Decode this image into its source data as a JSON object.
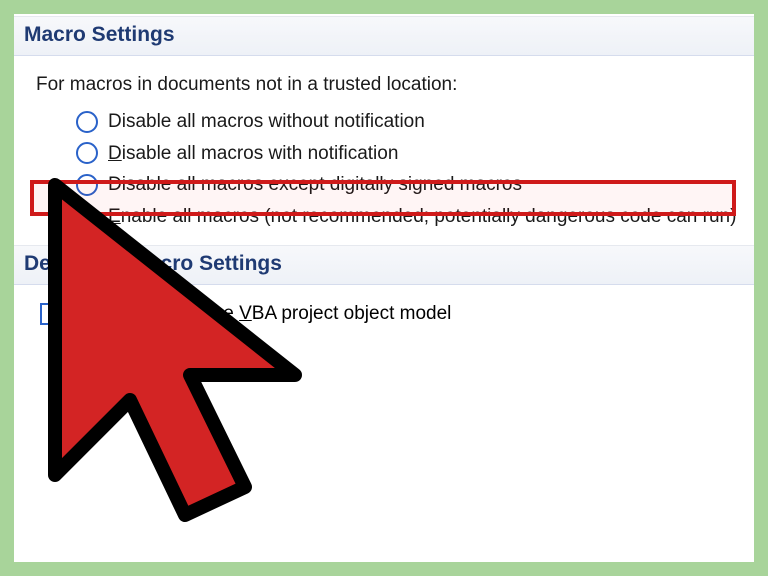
{
  "sections": {
    "macro_settings": {
      "title": "Macro Settings",
      "intro": "For macros in documents not in a trusted location:",
      "options": [
        {
          "pre": "",
          "accel": "",
          "label": "Disable all macros without notification",
          "checked": false
        },
        {
          "pre": "",
          "accel": "D",
          "label": "isable all macros with notification",
          "checked": false
        },
        {
          "pre": "Disable all macros except di",
          "accel": "g",
          "label": "itally signed macros",
          "checked": false
        },
        {
          "pre": "",
          "accel": "E",
          "label": "nable all macros (not recommended; potentially dangerous code can run)",
          "checked": true
        }
      ]
    },
    "developer_settings": {
      "title": "Developer Macro Settings",
      "checkbox": {
        "pre": "Trust access to the ",
        "accel": "V",
        "label": "BA project object model",
        "checked": false
      }
    }
  }
}
